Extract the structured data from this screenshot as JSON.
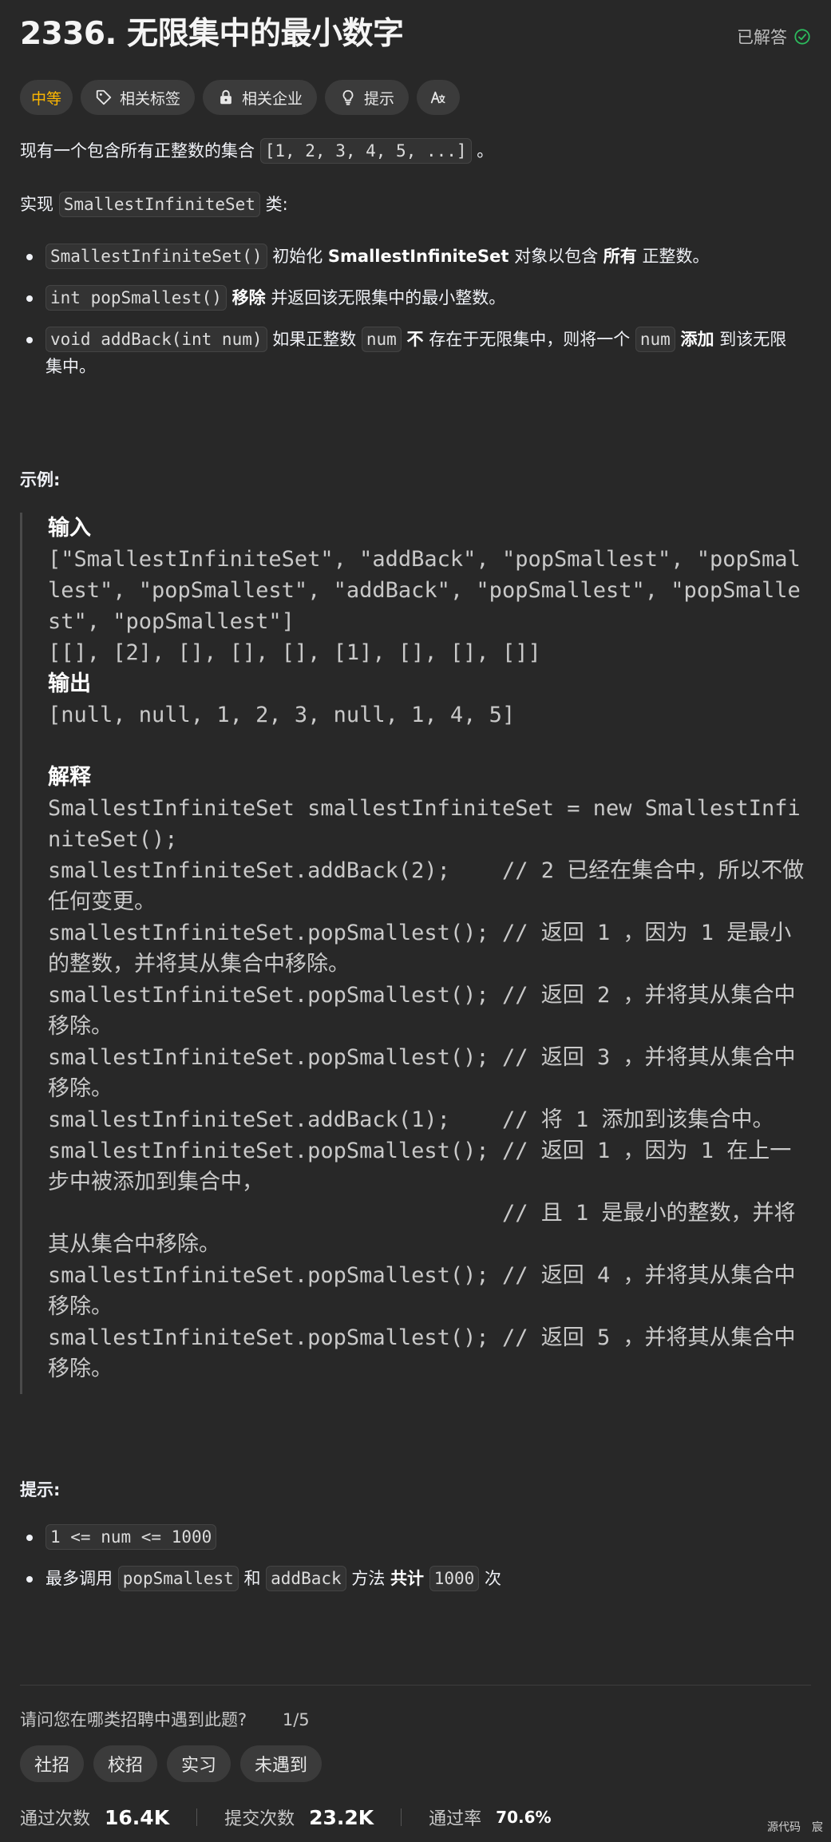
{
  "problem": {
    "title": "2336. 无限集中的最小数字",
    "status": "已解答"
  },
  "tags": {
    "difficulty": "中等",
    "related_tags": "相关标签",
    "related_companies": "相关企业",
    "hint": "提示",
    "translate_icon": "translate-icon"
  },
  "description": {
    "intro_text": "现有一个包含所有正整数的集合",
    "intro_code": "[1, 2, 3, 4, 5, ...]",
    "intro_end": "。",
    "impl_text": "实现",
    "impl_code": "SmallestInfiniteSet",
    "impl_end": "类:",
    "bullets": [
      {
        "code": "SmallestInfiniteSet()",
        "t1": "初始化",
        "b1": "SmallestInfiniteSet",
        "t2": "对象以包含",
        "b2": "所有",
        "t3": "正整数。"
      },
      {
        "code": "int popSmallest()",
        "b1": "移除",
        "t1": "并返回该无限集中的最小整数。"
      },
      {
        "code": "void addBack(int num)",
        "t1": "如果正整数",
        "code2": "num",
        "b1": "不",
        "t2": "存在于无限集中，则将一个",
        "code3": "num",
        "b2": "添加",
        "t3": "到该无限集中。"
      }
    ]
  },
  "example": {
    "heading": "示例:",
    "input_label": "输入",
    "input_lines": [
      "[\"SmallestInfiniteSet\", \"addBack\", \"popSmallest\", \"popSmallest\", \"popSmallest\", \"addBack\", \"popSmallest\", \"popSmallest\", \"popSmallest\"]",
      "[[], [2], [], [], [], [1], [], [], []]"
    ],
    "output_label": "输出",
    "output_line": "[null, null, 1, 2, 3, null, 1, 4, 5]",
    "explain_label": "解释",
    "explain_lines": [
      "SmallestInfiniteSet smallestInfiniteSet = new SmallestInfiniteSet();",
      "smallestInfiniteSet.addBack(2);    // 2 已经在集合中，所以不做任何变更。",
      "smallestInfiniteSet.popSmallest(); // 返回 1 ，因为 1 是最小的整数，并将其从集合中移除。",
      "smallestInfiniteSet.popSmallest(); // 返回 2 ，并将其从集合中移除。",
      "smallestInfiniteSet.popSmallest(); // 返回 3 ，并将其从集合中移除。",
      "smallestInfiniteSet.addBack(1);    // 将 1 添加到该集合中。",
      "smallestInfiniteSet.popSmallest(); // 返回 1 ，因为 1 在上一步中被添加到集合中，",
      "                                   // 且 1 是最小的整数，并将其从集合中移除。",
      "smallestInfiniteSet.popSmallest(); // 返回 4 ，并将其从集合中移除。",
      "smallestInfiniteSet.popSmallest(); // 返回 5 ，并将其从集合中移除。"
    ]
  },
  "constraints": {
    "heading": "提示:",
    "c1": "1 <= num <= 1000",
    "c2_t1": "最多调用",
    "c2_code1": "popSmallest",
    "c2_t2": "和",
    "c2_code2": "addBack",
    "c2_t3": "方法",
    "c2_b": "共计",
    "c2_code3": "1000",
    "c2_t4": "次"
  },
  "survey": {
    "question": "请问您在哪类招聘中遇到此题?",
    "page": "1/5",
    "options": [
      "社招",
      "校招",
      "实习",
      "未遇到"
    ]
  },
  "stats": {
    "accepted_label": "通过次数",
    "accepted_value": "16.4K",
    "submissions_label": "提交次数",
    "submissions_value": "23.2K",
    "rate_label": "通过率",
    "rate_value": "70.6%"
  },
  "footer": {
    "source": "源代码",
    "extra": "宸"
  },
  "colors": {
    "background": "#282828",
    "difficulty_medium": "#ffb800",
    "solved_check": "#2cbb5d"
  }
}
